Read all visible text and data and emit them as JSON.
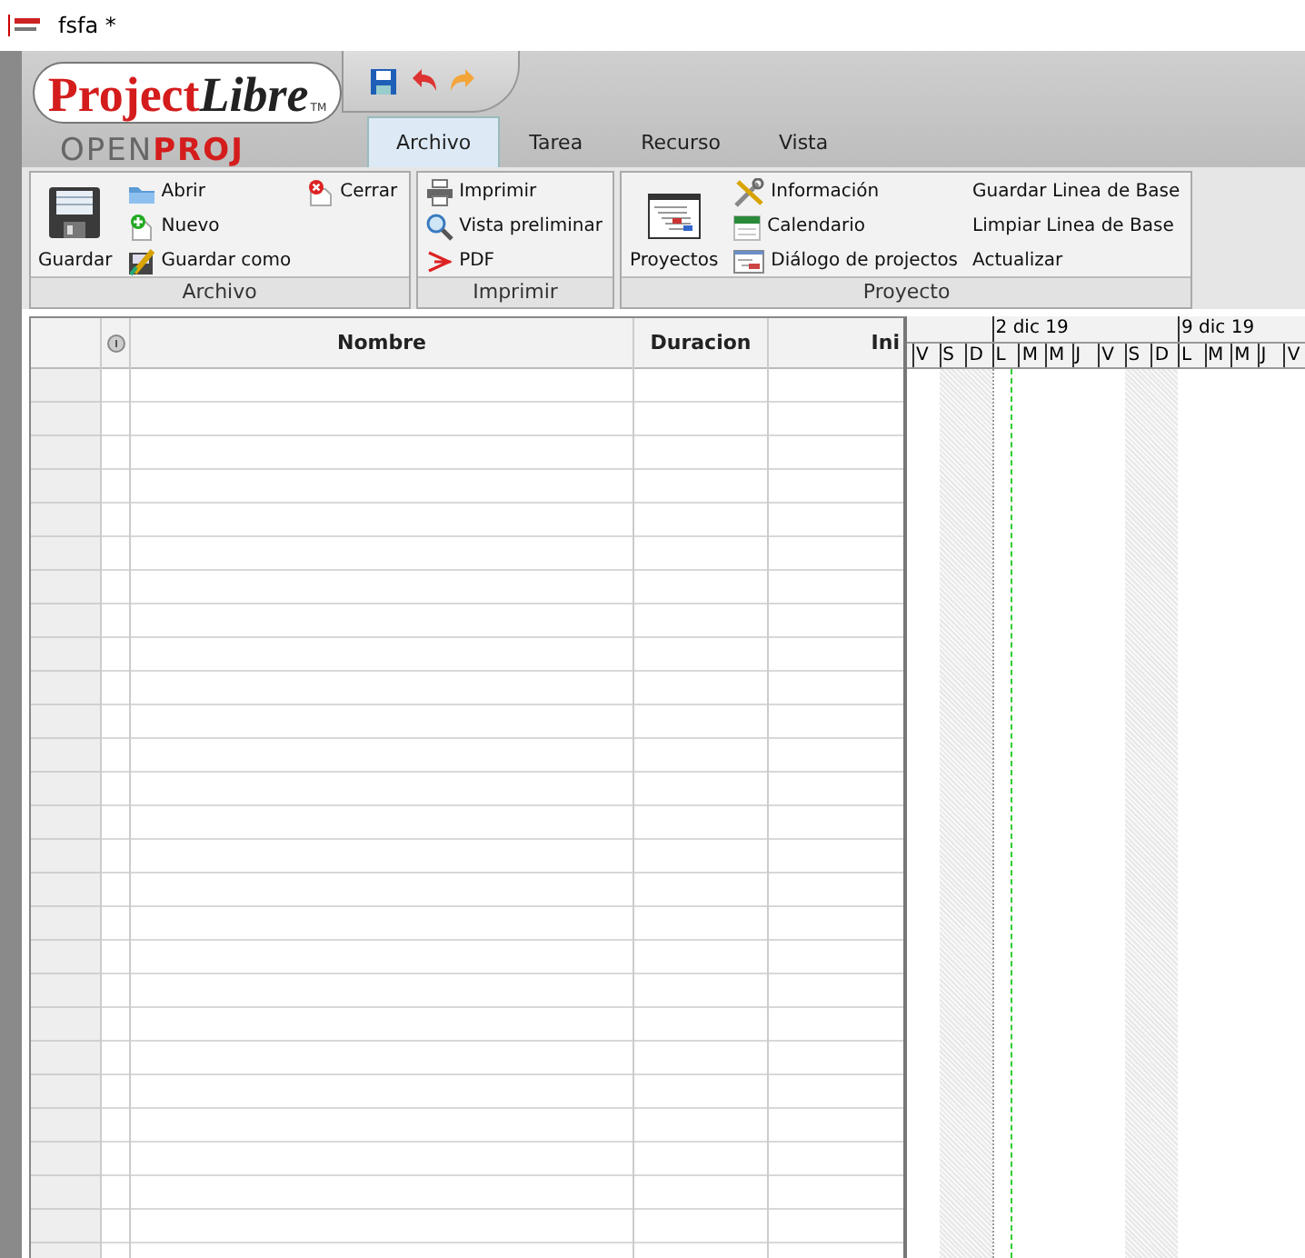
{
  "window": {
    "title": "fsfa *"
  },
  "logo": {
    "brand_main": "Project",
    "brand_accent": "Libre",
    "trademark": "TM",
    "sub_main": "OPEN",
    "sub_accent": "PROJ"
  },
  "tabs": [
    {
      "label": "Archivo",
      "selected": true
    },
    {
      "label": "Tarea",
      "selected": false
    },
    {
      "label": "Recurso",
      "selected": false
    },
    {
      "label": "Vista",
      "selected": false
    }
  ],
  "ribbon": {
    "groups": [
      {
        "label": "Archivo",
        "columns": [
          [
            {
              "label": "Guardar",
              "kind": "large"
            }
          ],
          [
            {
              "label": "Abrir",
              "kind": "small"
            },
            {
              "label": "Nuevo",
              "kind": "small"
            },
            {
              "label": "Guardar como",
              "kind": "small"
            }
          ],
          [
            {
              "label": "Cerrar",
              "kind": "small"
            }
          ]
        ]
      },
      {
        "label": "Imprimir",
        "columns": [
          [
            {
              "label": "Imprimir",
              "kind": "small"
            },
            {
              "label": "Vista preliminar",
              "kind": "small"
            },
            {
              "label": "PDF",
              "kind": "small"
            }
          ]
        ]
      },
      {
        "label": "Proyecto",
        "columns": [
          [
            {
              "label": "Proyectos",
              "kind": "large"
            }
          ],
          [
            {
              "label": "Información",
              "kind": "small"
            },
            {
              "label": "Calendario",
              "kind": "small"
            },
            {
              "label": "Diálogo de projectos",
              "kind": "small"
            }
          ],
          [
            {
              "label": "Guardar Linea de Base",
              "kind": "text"
            },
            {
              "label": "Limpiar Linea de Base",
              "kind": "text"
            },
            {
              "label": "Actualizar",
              "kind": "text"
            }
          ]
        ]
      }
    ]
  },
  "table": {
    "columns": [
      {
        "kind": "rowheader"
      },
      {
        "kind": "indicator"
      },
      {
        "label": "Nombre",
        "kind": "text"
      },
      {
        "label": "Duracion",
        "kind": "text"
      },
      {
        "label": "Ini",
        "kind": "text"
      }
    ]
  },
  "gantt": {
    "days": [
      {
        "label": "V",
        "weekend": false
      },
      {
        "label": "S",
        "weekend": true
      },
      {
        "label": "D",
        "weekend": true
      },
      {
        "label": "L",
        "weekend": false,
        "week": "2 dic 19"
      },
      {
        "label": "M",
        "weekend": false
      },
      {
        "label": "M",
        "weekend": false
      },
      {
        "label": "J",
        "weekend": false
      },
      {
        "label": "V",
        "weekend": false
      },
      {
        "label": "S",
        "weekend": true
      },
      {
        "label": "D",
        "weekend": true
      },
      {
        "label": "L",
        "weekend": false,
        "week": "9 dic 19"
      },
      {
        "label": "M",
        "weekend": false
      },
      {
        "label": "M",
        "weekend": false
      },
      {
        "label": "J",
        "weekend": false
      },
      {
        "label": "V",
        "weekend": false
      }
    ]
  }
}
